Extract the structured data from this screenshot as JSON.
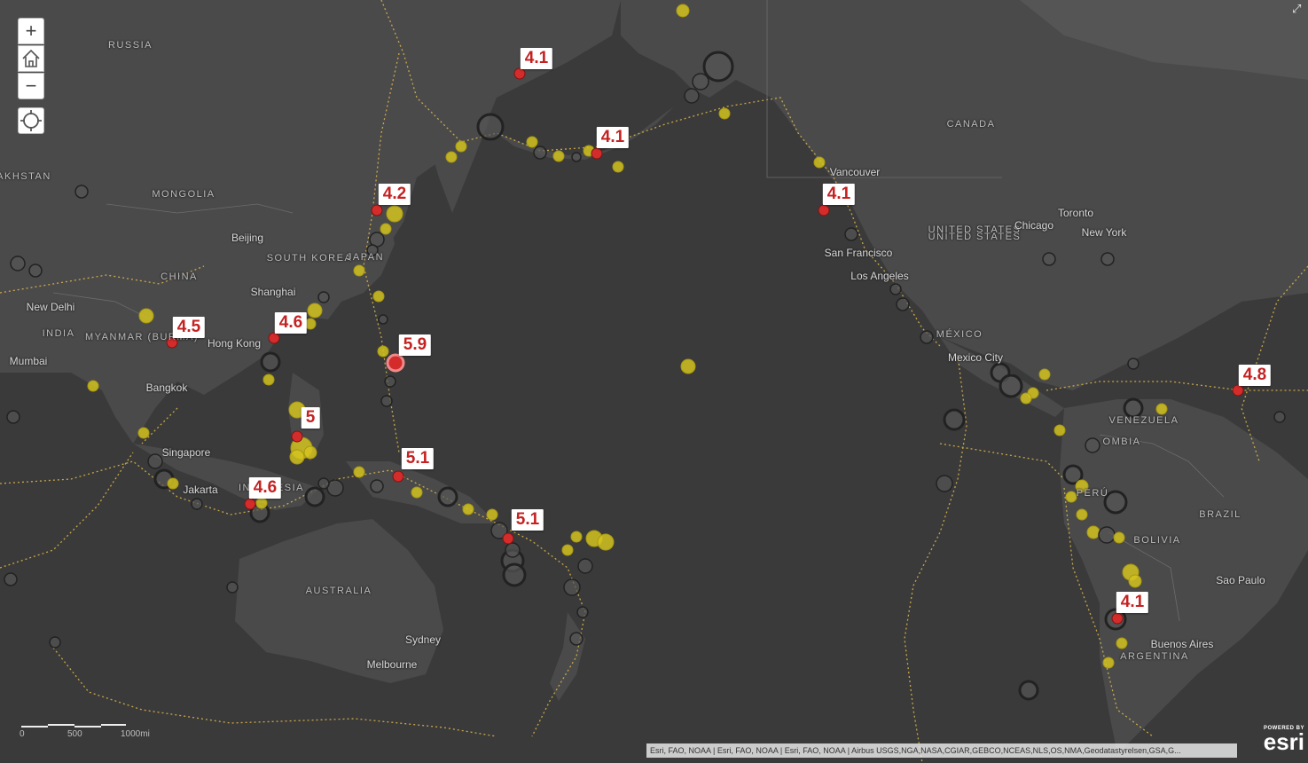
{
  "map": {
    "colors": {
      "ocean": "#3a3a3a",
      "land": "#4a4a4a",
      "recent_quake": "#d42b2b",
      "moderate_quake": "#d4c320",
      "old_quake": "#6a6a6a",
      "plate_boundary": "#d7b24a"
    },
    "places": [
      {
        "name": "RUSSIA",
        "type": "country"
      },
      {
        "name": "MONGOLIA",
        "type": "country"
      },
      {
        "name": "CHINA",
        "type": "country"
      },
      {
        "name": "INDIA",
        "type": "country"
      },
      {
        "name": "SOUTH KOREA",
        "type": "country"
      },
      {
        "name": "JAPAN",
        "type": "country"
      },
      {
        "name": "AUSTRALIA",
        "type": "country"
      },
      {
        "name": "CANADA",
        "type": "country"
      },
      {
        "name": "UNITED STATES",
        "type": "country"
      },
      {
        "name": "MÉXICO",
        "type": "country"
      },
      {
        "name": "BRAZIL",
        "type": "country"
      },
      {
        "name": "BOLIVIA",
        "type": "country"
      },
      {
        "name": "ARGENTINA",
        "type": "country"
      },
      {
        "name": "VENEZUELA",
        "type": "country"
      },
      {
        "name": "PERÚ",
        "type": "country"
      },
      {
        "name": "AKHSTAN",
        "type": "country"
      },
      {
        "name": "UNITED STATES",
        "type": "country"
      },
      {
        "name": "INDONESIA",
        "type": "country"
      },
      {
        "name": "OMBIA",
        "type": "country"
      },
      {
        "name": "Beijing",
        "type": "city"
      },
      {
        "name": "Shanghai",
        "type": "city"
      },
      {
        "name": "Hong Kong",
        "type": "city"
      },
      {
        "name": "Bangkok",
        "type": "city"
      },
      {
        "name": "New Delhi",
        "type": "city"
      },
      {
        "name": "Mumbai",
        "type": "city"
      },
      {
        "name": "Singapore",
        "type": "city"
      },
      {
        "name": "Jakarta",
        "type": "city"
      },
      {
        "name": "Sydney",
        "type": "city"
      },
      {
        "name": "Melbourne",
        "type": "city"
      },
      {
        "name": "Vancouver",
        "type": "city"
      },
      {
        "name": "San Francisco",
        "type": "city"
      },
      {
        "name": "Los Angeles",
        "type": "city"
      },
      {
        "name": "Chicago",
        "type": "city"
      },
      {
        "name": "Toronto",
        "type": "city"
      },
      {
        "name": "New York",
        "type": "city"
      },
      {
        "name": "Mexico City",
        "type": "city"
      },
      {
        "name": "Sao Paulo",
        "type": "city"
      },
      {
        "name": "Buenos Aires",
        "type": "city"
      },
      {
        "name": "MYANMAR (BURMA)",
        "type": "country"
      }
    ],
    "magnitudes": [
      "4.1",
      "4.1",
      "4.2",
      "4.1",
      "4.5",
      "4.6",
      "5.9",
      "5",
      "5.1",
      "4.6",
      "5.1",
      "4.1",
      "4.8"
    ]
  },
  "controls": {
    "zoom_in": "+",
    "zoom_out": "−",
    "home_icon": "home-icon",
    "locate_icon": "locate-icon"
  },
  "scale": {
    "labels": [
      "0",
      "500",
      "1000mi"
    ]
  },
  "attribution": "Esri, FAO, NOAA | Esri, FAO, NOAA | Esri, FAO, NOAA | Airbus USGS,NGA,NASA,CGIAR,GEBCO,NCEAS,NLS,OS,NMA,Geodatastyrelsen,GSA,G...",
  "logo": {
    "powered_by": "POWERED BY",
    "name": "esri"
  }
}
